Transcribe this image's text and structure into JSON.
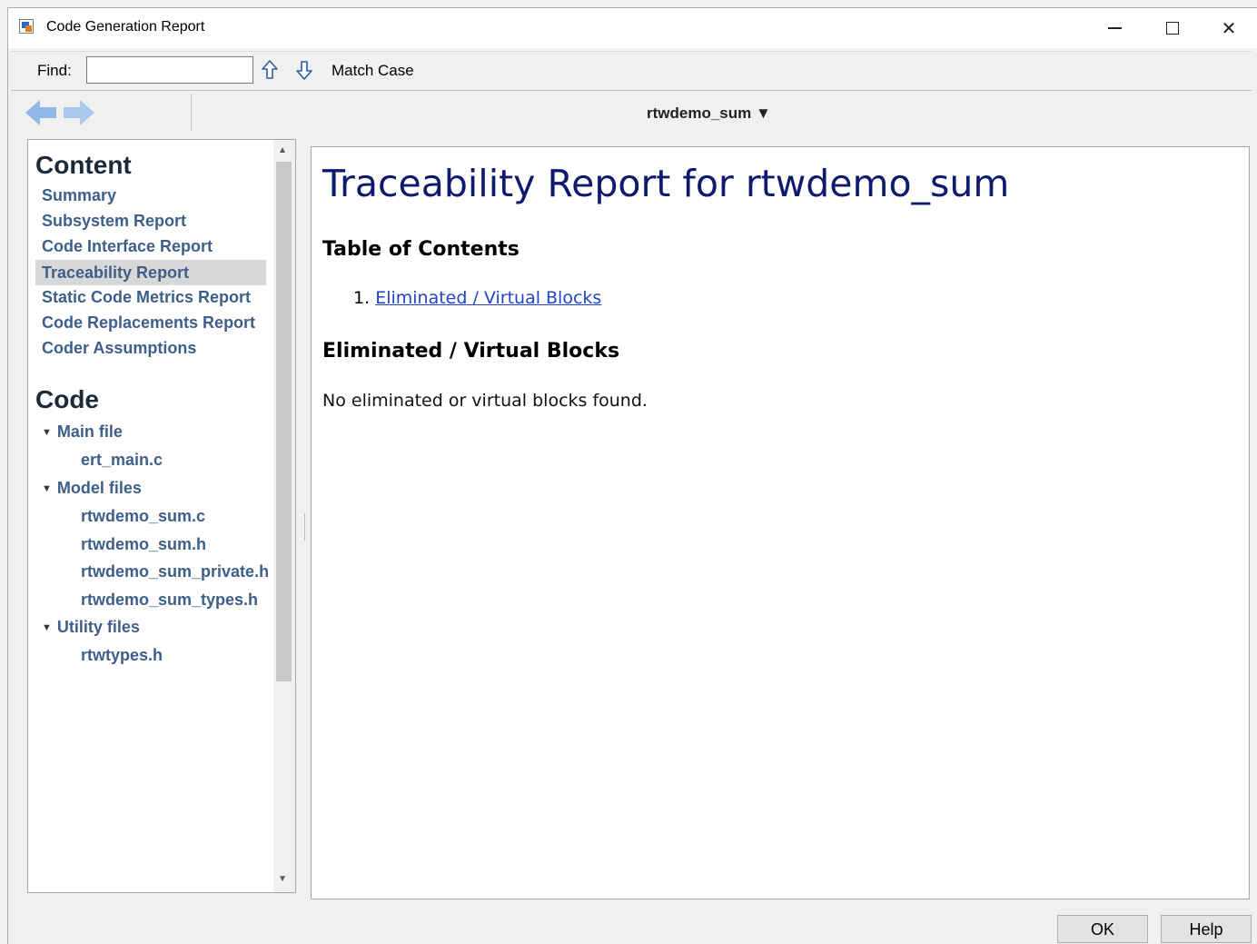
{
  "window": {
    "title": "Code Generation Report"
  },
  "findbar": {
    "find_label": "Find:",
    "find_value": "",
    "match_case_label": "Match Case"
  },
  "navbar": {
    "model_label": "rtwdemo_sum ▼"
  },
  "sidebar": {
    "content_heading": "Content",
    "content_items": [
      {
        "label": "Summary"
      },
      {
        "label": "Subsystem Report"
      },
      {
        "label": "Code Interface Report"
      },
      {
        "label": "Traceability Report",
        "selected": true
      },
      {
        "label": "Static Code Metrics Report"
      },
      {
        "label": "Code Replacements Report"
      },
      {
        "label": "Coder Assumptions"
      }
    ],
    "code_heading": "Code",
    "groups": [
      {
        "label": "Main file",
        "files": [
          "ert_main.c"
        ]
      },
      {
        "label": "Model files",
        "files": [
          "rtwdemo_sum.c",
          "rtwdemo_sum.h",
          "rtwdemo_sum_private.h",
          "rtwdemo_sum_types.h"
        ]
      },
      {
        "label": "Utility files",
        "files": [
          "rtwtypes.h"
        ]
      }
    ]
  },
  "main": {
    "title": "Traceability Report for rtwdemo_sum",
    "toc_heading": "Table of Contents",
    "toc_items": [
      {
        "number": "1.",
        "label": "Eliminated / Virtual Blocks"
      }
    ],
    "section_heading": "Eliminated / Virtual Blocks",
    "section_text": "No eliminated or virtual blocks found."
  },
  "footer": {
    "ok_label": "OK",
    "help_label": "Help"
  },
  "colors": {
    "link": "#3d5f8a",
    "title": "#0d1a6e",
    "toc_link": "#2246c8",
    "nav_arrow": "#8fb8e8"
  }
}
